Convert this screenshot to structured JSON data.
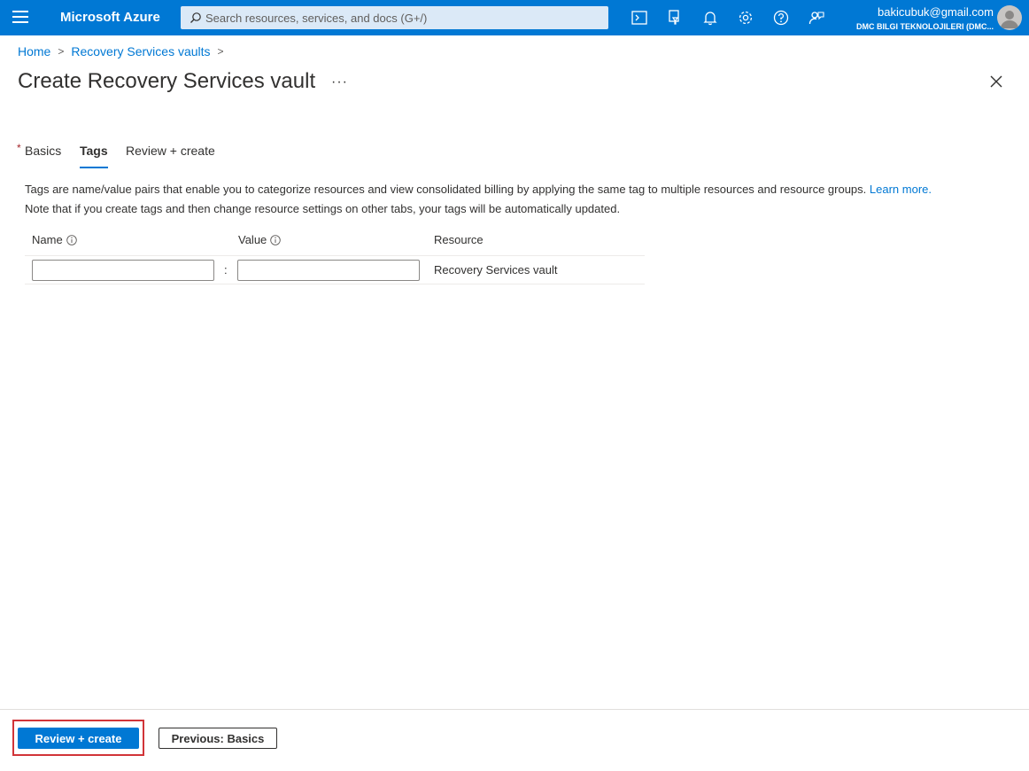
{
  "topbar": {
    "brand": "Microsoft Azure",
    "search_placeholder": "Search resources, services, and docs (G+/)",
    "icons": [
      "menu-icon",
      "search-icon",
      "cloud-shell-icon",
      "directory-filter-icon",
      "notifications-icon",
      "settings-icon",
      "help-icon",
      "feedback-icon"
    ],
    "account_email": "bakicubuk@gmail.com",
    "account_org": "DMC BILGI TEKNOLOJILERI (DMC..."
  },
  "breadcrumb": {
    "home": "Home",
    "vaults": "Recovery Services vaults",
    "separator": ">"
  },
  "page": {
    "title": "Create Recovery Services vault",
    "more": "···"
  },
  "tabs": {
    "basics": "Basics",
    "required_marker": "*",
    "tags": "Tags",
    "review": "Review + create",
    "active": "Tags"
  },
  "description": {
    "line1": "Tags are name/value pairs that enable you to categorize resources and view consolidated billing by applying the same tag to multiple resources and resource groups.",
    "learn_more": "Learn more.",
    "line2": "Note that if you create tags and then change resource settings on other tabs, your tags will be automatically updated."
  },
  "tag_grid": {
    "col_name": "Name",
    "col_value": "Value",
    "col_resource": "Resource",
    "separator": ":",
    "rows": [
      {
        "name": "",
        "value": "",
        "resource": "Recovery Services vault"
      }
    ]
  },
  "footer": {
    "review_create": "Review + create",
    "previous": "Previous: Basics"
  },
  "colors": {
    "accent": "#0078d4",
    "highlight_box": "#d13438"
  }
}
